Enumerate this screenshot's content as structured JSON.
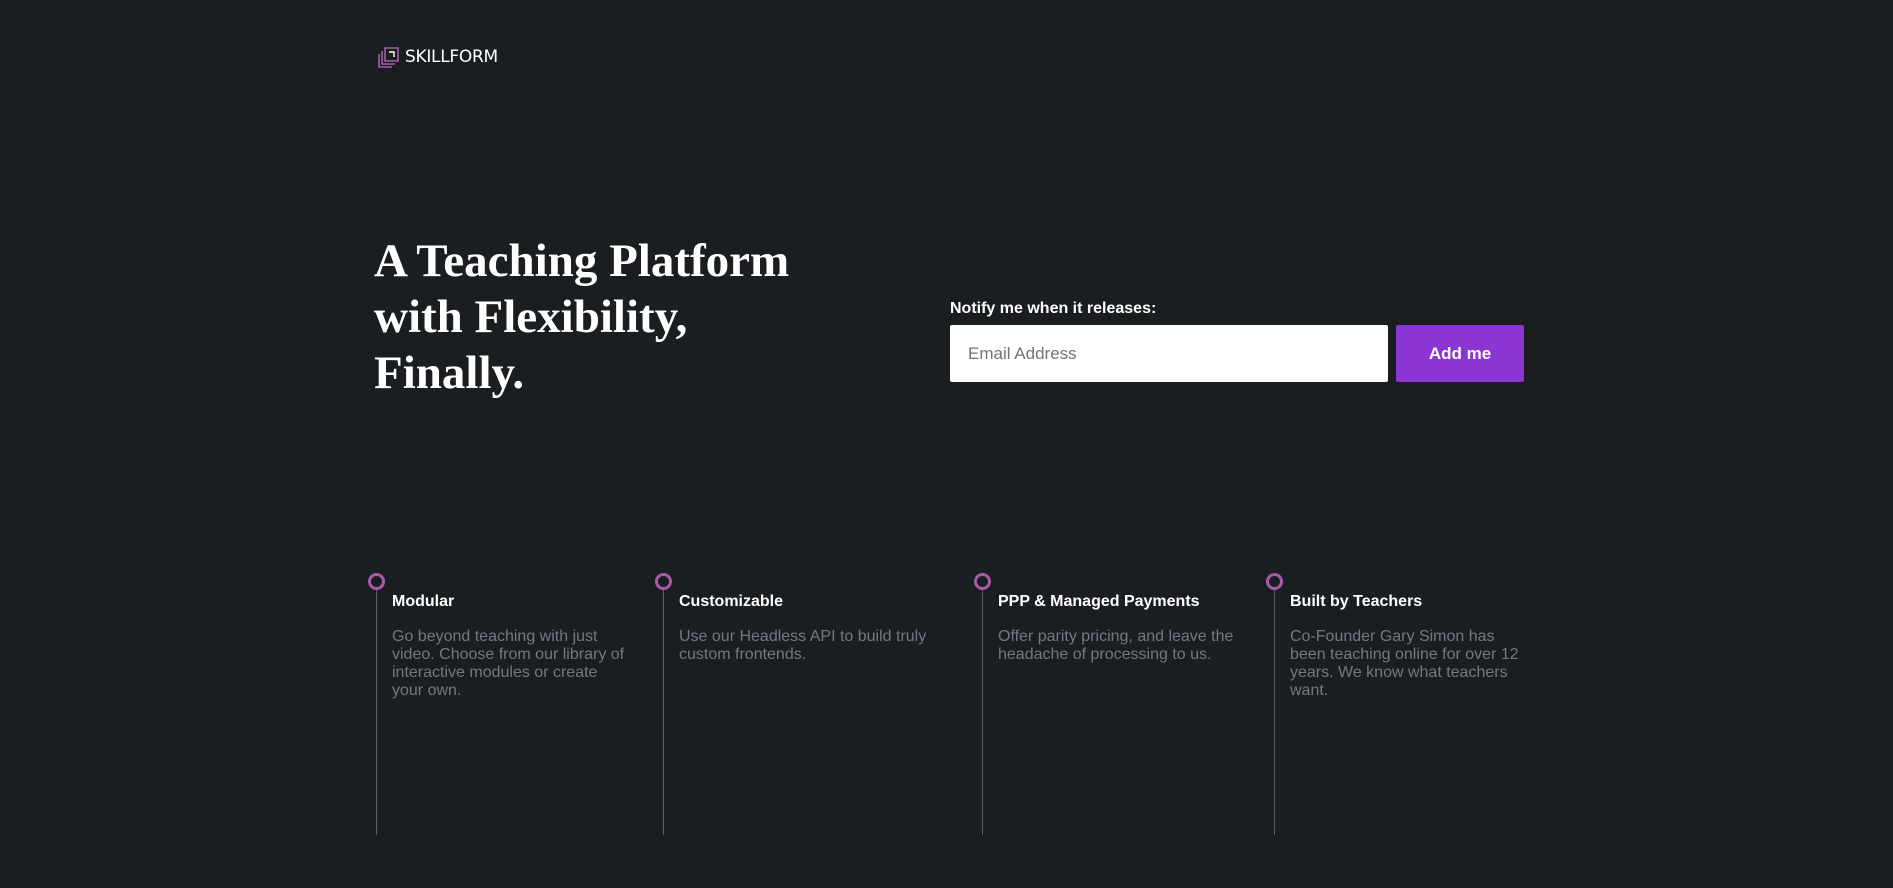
{
  "brand": {
    "name": "SKILLFORM",
    "icon": "layered-squares-icon",
    "accent_color": "#a85aa8"
  },
  "hero": {
    "title_lines": [
      "A Teaching Platform",
      "with Flexibility,",
      "Finally."
    ]
  },
  "signup": {
    "label": "Notify me when it releases:",
    "email_placeholder": "Email Address",
    "email_value": "",
    "button_label": "Add me",
    "button_color": "#8a35d4"
  },
  "features": [
    {
      "title": "Modular",
      "description": "Go beyond teaching with just video. Choose from our library of interactive modules or create your own."
    },
    {
      "title": "Customizable",
      "description": "Use our Headless API to build truly custom frontends."
    },
    {
      "title": "PPP & Managed Payments",
      "description": "Offer parity pricing, and leave the headache of processing to us."
    },
    {
      "title": "Built by Teachers",
      "description": "Co-Founder Gary Simon has been teaching online for over 12 years. We know what teachers want."
    }
  ]
}
